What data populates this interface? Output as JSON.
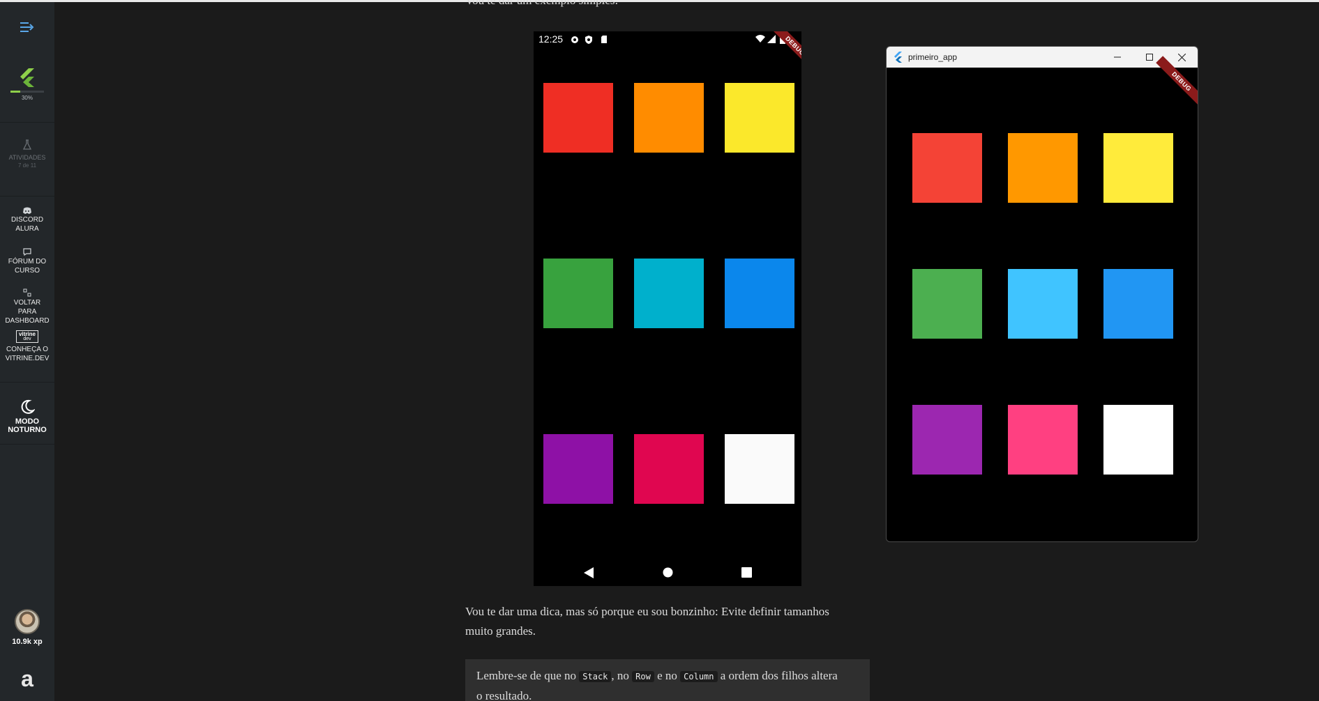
{
  "sidebar": {
    "progress": "30%",
    "activities": {
      "label": "ATIVIDADES",
      "count": "7 de 11"
    },
    "discord": [
      "DISCORD",
      "ALURA"
    ],
    "forum": [
      "FÓRUM DO",
      "CURSO"
    ],
    "dashboard": [
      "VOLTAR",
      "PARA",
      "DASHBOARD"
    ],
    "vitrine_logo": [
      "vitrine",
      "dev"
    ],
    "vitrine": [
      "CONHEÇA O",
      "VITRINE.DEV"
    ],
    "night_mode": [
      "MODO",
      "NOTURNO"
    ],
    "xp": "10.9k xp",
    "logo": "a"
  },
  "article": {
    "intro": "Vou te dar um exemplo simples:",
    "tip_line1": "Vou te dar uma dica, mas só porque eu sou bonzinho: Evite definir tamanhos",
    "tip_line2": "muito grandes.",
    "callout": {
      "t1": "Lembre-se de que no ",
      "c1": "Stack",
      "t2": ", no ",
      "c2": "Row",
      "t3": " e no ",
      "c3": "Column",
      "t4": " a ordem dos filhos altera",
      "t5": "o resultado."
    }
  },
  "phone": {
    "time": "12:25",
    "debug": "DEBUG",
    "colors": [
      "#ef2e24",
      "#ff8c00",
      "#fbe82b",
      "#38a23e",
      "#00b0cc",
      "#0b87ec",
      "#8e11a6",
      "#e00650",
      "#fafafa"
    ]
  },
  "window": {
    "title": "primeiro_app",
    "debug": "DEBUG",
    "colors": [
      "#f44336",
      "#ff9800",
      "#ffeb3b",
      "#4caf50",
      "#40c4ff",
      "#2196f3",
      "#9c27b0",
      "#ff4081",
      "#ffffff"
    ]
  }
}
